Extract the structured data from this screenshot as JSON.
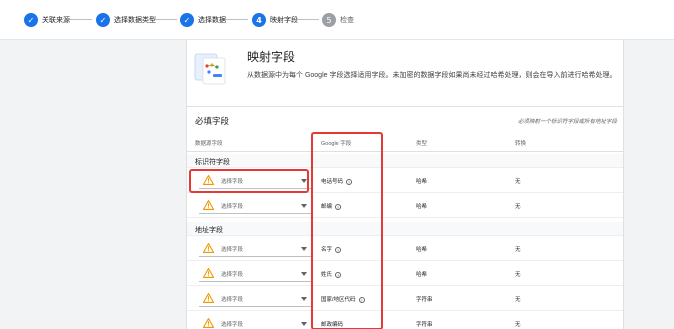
{
  "stepper": {
    "steps": [
      {
        "label": "关联来源",
        "status": "done",
        "mark": "✓"
      },
      {
        "label": "选择数据类型",
        "status": "done",
        "mark": "✓"
      },
      {
        "label": "选择数据",
        "status": "done",
        "mark": "✓"
      },
      {
        "label": "映射字段",
        "status": "active",
        "mark": "4"
      },
      {
        "label": "检查",
        "status": "todo",
        "mark": "5"
      }
    ]
  },
  "header": {
    "title": "映射字段",
    "description": "从数据源中为每个 Google 字段选择适用字段。未加密的数据字段如果尚未经过哈希处理，则会在导入前进行哈希处理。"
  },
  "section": {
    "title": "必填字段",
    "note": "必须映射一个标识符字段或所有地址字段",
    "columns": {
      "source": "数据源字段",
      "google": "Google 字段",
      "type": "类型",
      "transform": "转换"
    },
    "groups": [
      {
        "label": "标识符字段"
      },
      {
        "label": "地址字段"
      }
    ],
    "rows": [
      {
        "placeholder": "选择字段",
        "google_field": "电话号码",
        "type": "哈希",
        "transform": "无"
      },
      {
        "placeholder": "选择字段",
        "google_field": "邮编",
        "type": "哈希",
        "transform": "无"
      },
      {
        "placeholder": "选择字段",
        "google_field": "名字",
        "type": "哈希",
        "transform": "无"
      },
      {
        "placeholder": "选择字段",
        "google_field": "姓氏",
        "type": "哈希",
        "transform": "无"
      },
      {
        "placeholder": "选择字段",
        "google_field": "国家/地区代码",
        "type": "字符串",
        "transform": "无"
      },
      {
        "placeholder": "选择字段",
        "google_field": "邮政编码",
        "type": "字符串",
        "transform": "无"
      }
    ]
  },
  "colors": {
    "accent": "#1a73e8",
    "warning": "#f29900",
    "highlight": "#e53935"
  },
  "icons": {
    "done": "check-icon",
    "warning": "warning-triangle-icon",
    "help": "help-circle-icon",
    "dropdown": "dropdown-arrow-icon"
  }
}
